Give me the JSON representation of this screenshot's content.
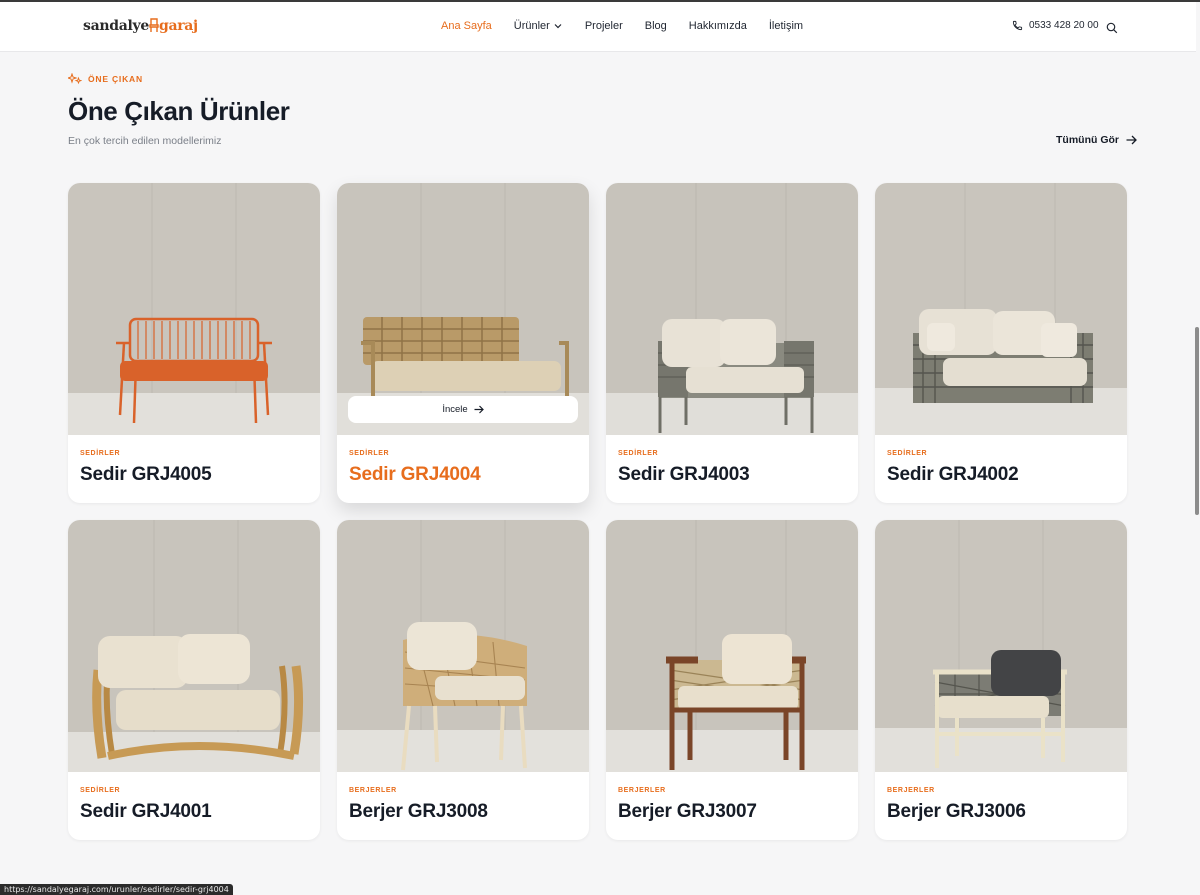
{
  "header": {
    "logo_part1": "sandalye",
    "logo_part2": "garaj",
    "nav": [
      {
        "label": "Ana Sayfa",
        "active": true
      },
      {
        "label": "Ürünler",
        "has_dropdown": true
      },
      {
        "label": "Projeler"
      },
      {
        "label": "Blog"
      },
      {
        "label": "Hakkımızda"
      },
      {
        "label": "İletişim"
      }
    ],
    "phone": "0533 428 20 00",
    "phone_icon": "phone-icon",
    "search_icon": "search-icon"
  },
  "section": {
    "eyebrow": "ÖNE ÇIKAN",
    "eyebrow_icon": "sparkle-icon",
    "title": "Öne Çıkan Ürünler",
    "subtitle": "En çok tercih edilen modellerimiz",
    "see_all": "Tümünü Gör"
  },
  "products": [
    {
      "category": "SEDİRLER",
      "name": "Sedir GRJ4005"
    },
    {
      "category": "SEDİRLER",
      "name": "Sedir GRJ4004",
      "hovered": true,
      "action": "İncele"
    },
    {
      "category": "SEDİRLER",
      "name": "Sedir GRJ4003"
    },
    {
      "category": "SEDİRLER",
      "name": "Sedir GRJ4002"
    },
    {
      "category": "SEDİRLER",
      "name": "Sedir GRJ4001"
    },
    {
      "category": "BERJERLER",
      "name": "Berjer GRJ3008"
    },
    {
      "category": "BERJERLER",
      "name": "Berjer GRJ3007"
    },
    {
      "category": "BERJERLER",
      "name": "Berjer GRJ3006"
    }
  ],
  "status_bar": {
    "url": "https://sandalyegaraj.com/urunler/sedirler/sedir-grj4004"
  },
  "colors": {
    "accent": "#e76d1d",
    "text": "#161c27",
    "background": "#f6f6f7"
  }
}
